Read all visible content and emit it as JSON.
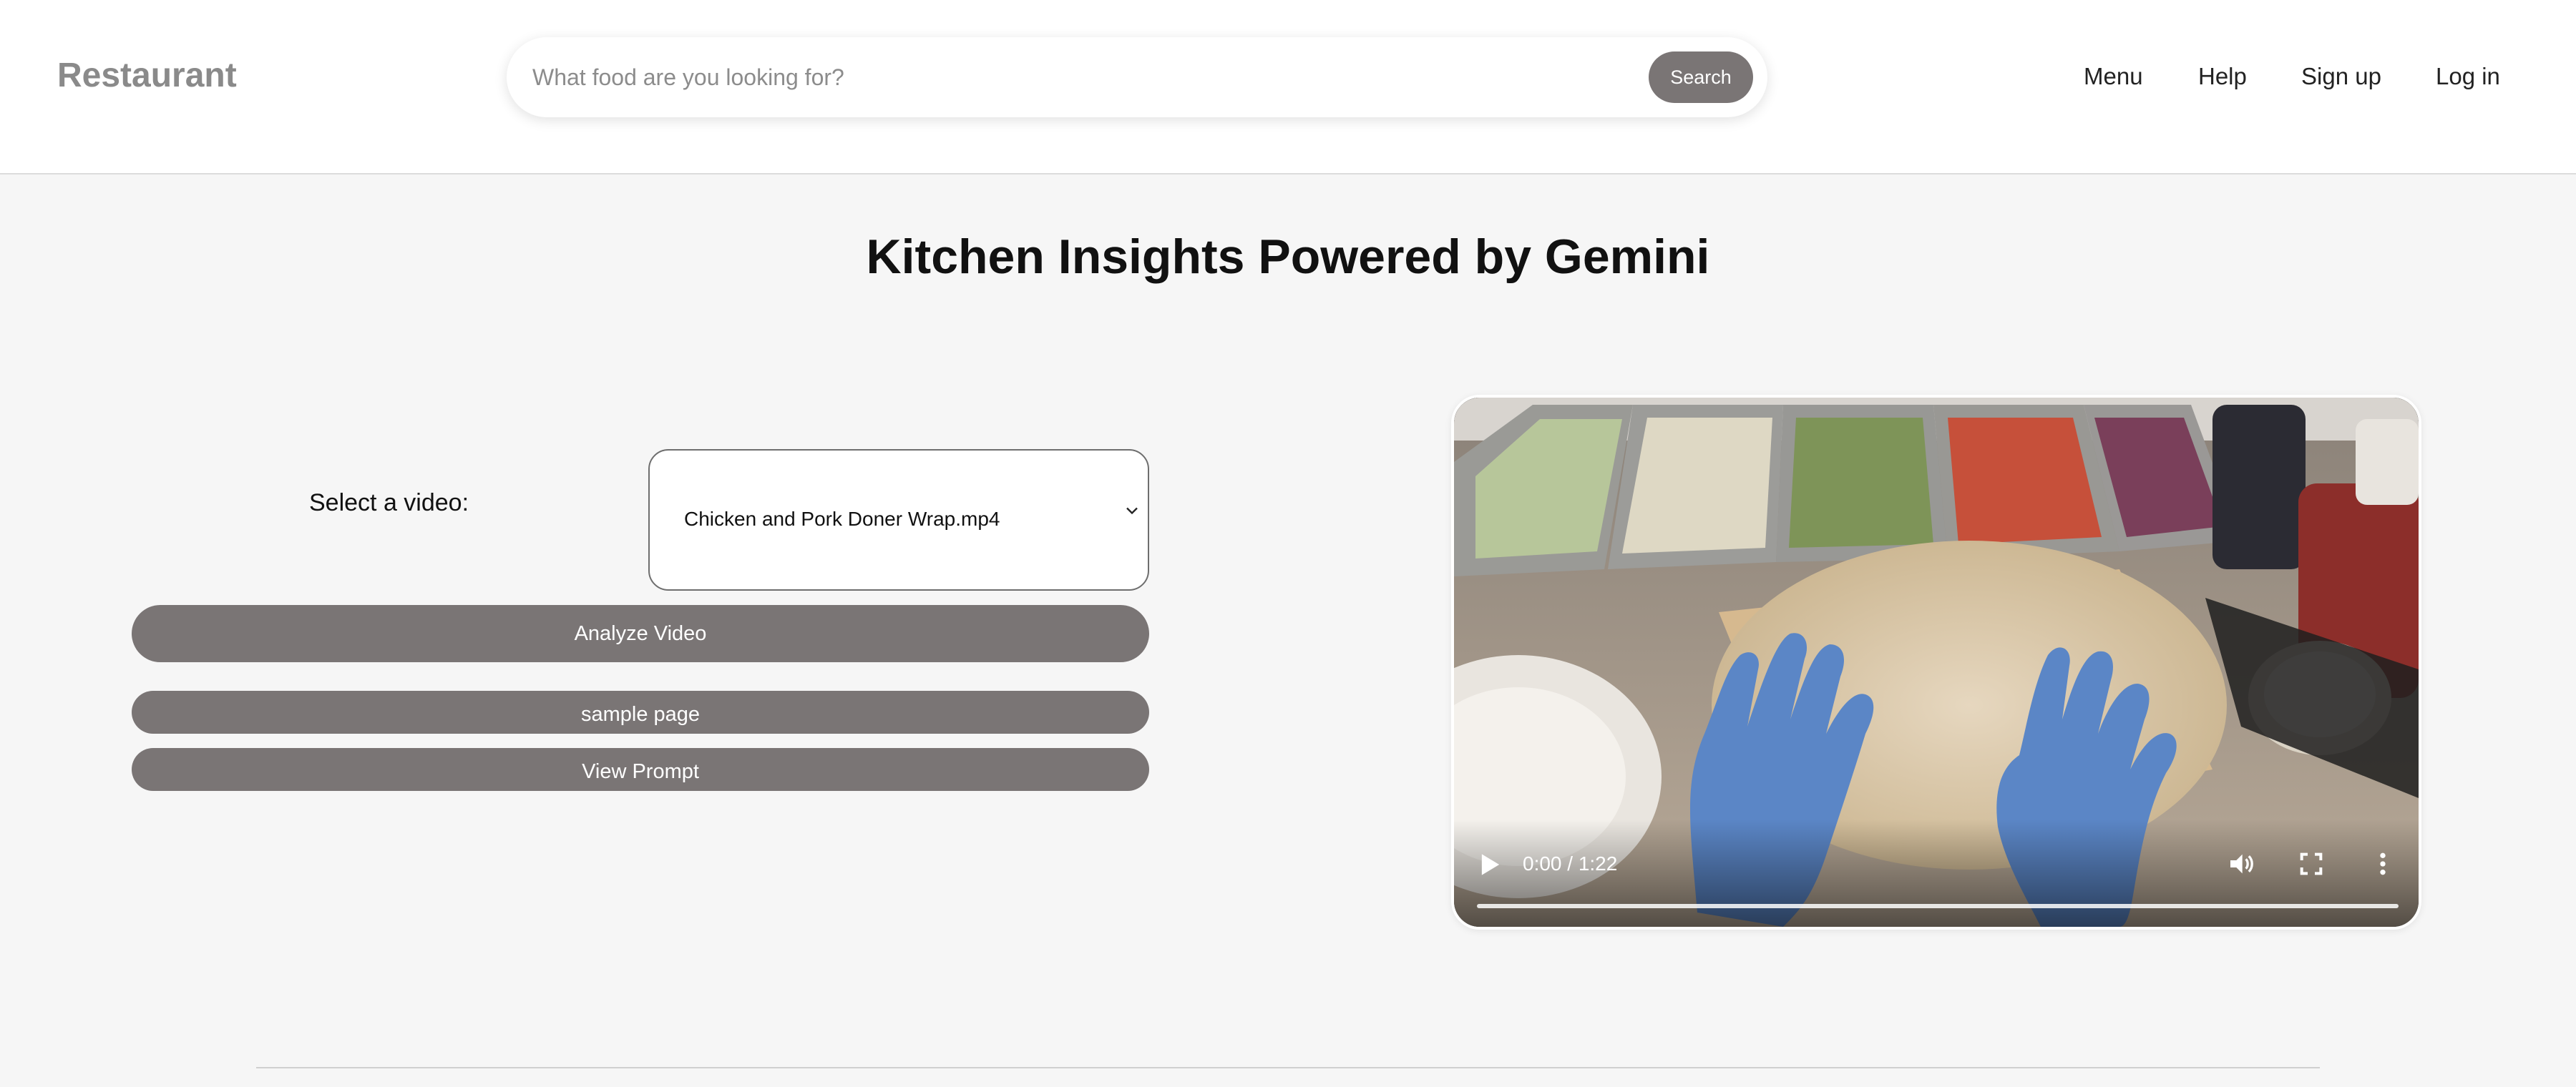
{
  "header": {
    "brand": "Restaurant",
    "search": {
      "placeholder": "What food are you looking for?",
      "button_label": "Search"
    },
    "nav": [
      {
        "label": "Menu"
      },
      {
        "label": "Help"
      },
      {
        "label": "Sign up"
      },
      {
        "label": "Log in"
      }
    ]
  },
  "main": {
    "title": "Kitchen Insights Powered by Gemini",
    "select_label": "Select a video:",
    "select_value": "Chicken and Pork Doner Wrap.mp4",
    "buttons": {
      "analyze": "Analyze Video",
      "sample": "sample page",
      "prompt": "View Prompt"
    }
  },
  "video": {
    "time": "0:00 / 1:22",
    "progress": 0,
    "icons": [
      "play-icon",
      "volume-icon",
      "fullscreen-icon",
      "more-options-icon"
    ]
  },
  "colors": {
    "button_bg": "#7a7575",
    "brand": "#8a8a8a",
    "page_bg": "#f6f6f6"
  }
}
